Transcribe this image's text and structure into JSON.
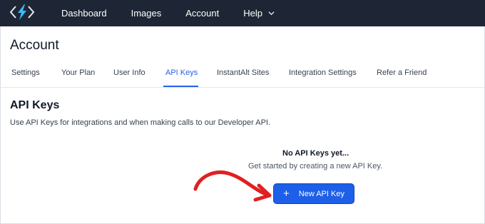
{
  "navbar": {
    "items": [
      {
        "label": "Dashboard"
      },
      {
        "label": "Images"
      },
      {
        "label": "Account"
      },
      {
        "label": "Help"
      }
    ]
  },
  "page": {
    "title": "Account"
  },
  "tabs": [
    {
      "label": "Settings"
    },
    {
      "label": "Your Plan"
    },
    {
      "label": "User Info"
    },
    {
      "label": "API Keys",
      "active": true
    },
    {
      "label": "InstantAlt Sites"
    },
    {
      "label": "Integration Settings"
    },
    {
      "label": "Refer a Friend"
    }
  ],
  "api_keys": {
    "title": "API Keys",
    "description": "Use API Keys for integrations and when making calls to our Developer API.",
    "empty_title": "No API Keys yet...",
    "empty_subtitle": "Get started by creating a new API Key.",
    "button_label": "New API Key",
    "button_icon": "+"
  },
  "colors": {
    "topbar": "#1e2635",
    "accent": "#2563eb",
    "button": "#1d5fe8",
    "arrow": "#e02020",
    "logo_bolt": "#38bdf8"
  },
  "icons": {
    "logo": "code-bolt-logo",
    "help_menu": "chevron-down-icon",
    "annotation": "red-arrow-annotation",
    "add": "plus-icon"
  }
}
